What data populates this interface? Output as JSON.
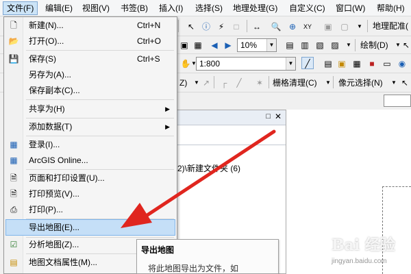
{
  "menubar": {
    "items": [
      "文件(F)",
      "编辑(E)",
      "视图(V)",
      "书签(B)",
      "插入(I)",
      "选择(S)",
      "地理处理(G)",
      "自定义(C)",
      "窗口(W)",
      "帮助(H)"
    ]
  },
  "toolbar": {
    "georef_label": "地理配准(",
    "scale_value": "1:800",
    "zoom_value": "10%",
    "draw_label": "绘制(D)",
    "raster_clean_label": "栅格清理(C)",
    "pixel_select_label": "像元选择(N)",
    "z_label": "Z)"
  },
  "toc": {
    "path_text": "2)\\新建文件夹 (6)"
  },
  "file_menu": {
    "items": [
      {
        "label": "新建(N)...",
        "shortcut": "Ctrl+N",
        "icon": "new-doc-icon"
      },
      {
        "label": "打开(O)...",
        "shortcut": "Ctrl+O",
        "icon": "open-folder-icon"
      },
      {
        "label": "保存(S)",
        "shortcut": "Ctrl+S",
        "icon": "save-icon"
      },
      {
        "label": "另存为(A)...",
        "shortcut": "",
        "icon": ""
      },
      {
        "label": "保存副本(C)...",
        "shortcut": "",
        "icon": ""
      },
      {
        "label": "共享为(H)",
        "shortcut": "",
        "icon": "",
        "submenu": true
      },
      {
        "label": "添加数据(T)",
        "shortcut": "",
        "icon": "",
        "submenu": true
      },
      {
        "label": "登录(I)...",
        "shortcut": "",
        "icon": "signin-icon"
      },
      {
        "label": "ArcGIS Online...",
        "shortcut": "",
        "icon": "arcgis-online-icon"
      },
      {
        "label": "页面和打印设置(U)...",
        "shortcut": "",
        "icon": "page-setup-icon"
      },
      {
        "label": "打印预览(V)...",
        "shortcut": "",
        "icon": "print-preview-icon"
      },
      {
        "label": "打印(P)...",
        "shortcut": "",
        "icon": "print-icon"
      },
      {
        "label": "导出地图(E)...",
        "shortcut": "",
        "icon": "",
        "highlighted": true
      },
      {
        "label": "分析地图(Z)...",
        "shortcut": "",
        "icon": "analyze-map-icon"
      },
      {
        "label": "地图文档属性(M)...",
        "shortcut": "",
        "icon": "map-properties-icon"
      }
    ]
  },
  "tooltip": {
    "title": "导出地图",
    "body": "将此地图导出为文件，如"
  },
  "watermark": {
    "logo": "Bai 经验",
    "url": "jingyan.baidu.com"
  },
  "colors": {
    "highlight": "#c5dff7",
    "arrow": "#e0261f"
  }
}
